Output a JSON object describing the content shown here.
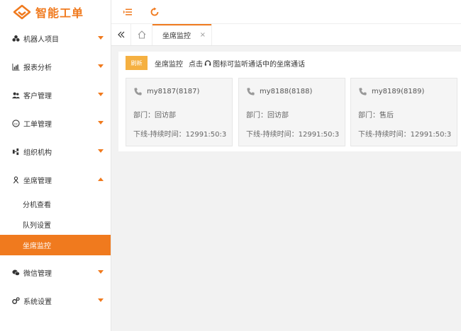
{
  "app": {
    "title": "智能工单",
    "accent": "#f07a1e"
  },
  "sidebar": {
    "items": [
      {
        "label": "机器人项目",
        "icon": "robot-icon"
      },
      {
        "label": "报表分析",
        "icon": "bar-chart-icon"
      },
      {
        "label": "客户管理",
        "icon": "users-icon"
      },
      {
        "label": "工单管理",
        "icon": "ticket-icon"
      },
      {
        "label": "组织机构",
        "icon": "org-icon"
      },
      {
        "label": "坐席管理",
        "icon": "agent-icon",
        "expanded": true
      },
      {
        "label": "微信管理",
        "icon": "wechat-icon"
      },
      {
        "label": "系统设置",
        "icon": "settings-icon"
      }
    ],
    "subitems": [
      {
        "label": "分机查看"
      },
      {
        "label": "队列设置"
      },
      {
        "label": "坐席监控",
        "active": true
      }
    ]
  },
  "tabs": [
    {
      "label": "坐席监控",
      "close": "×"
    }
  ],
  "monitor": {
    "refresh_label": "刷新",
    "title": "坐席监控",
    "hint_prefix": "点击",
    "hint_suffix": "图标可监听通话中的坐席通话",
    "cards": [
      {
        "name": "my8187(8187)",
        "dept": "部门：回访部",
        "status": "下线-持续时间：12991:50:3"
      },
      {
        "name": "my8188(8188)",
        "dept": "部门：回访部",
        "status": "下线-持续时间：12991:50:3"
      },
      {
        "name": "my8189(8189)",
        "dept": "部门：售后",
        "status": "下线-持续时间：12991:50:3"
      }
    ]
  }
}
